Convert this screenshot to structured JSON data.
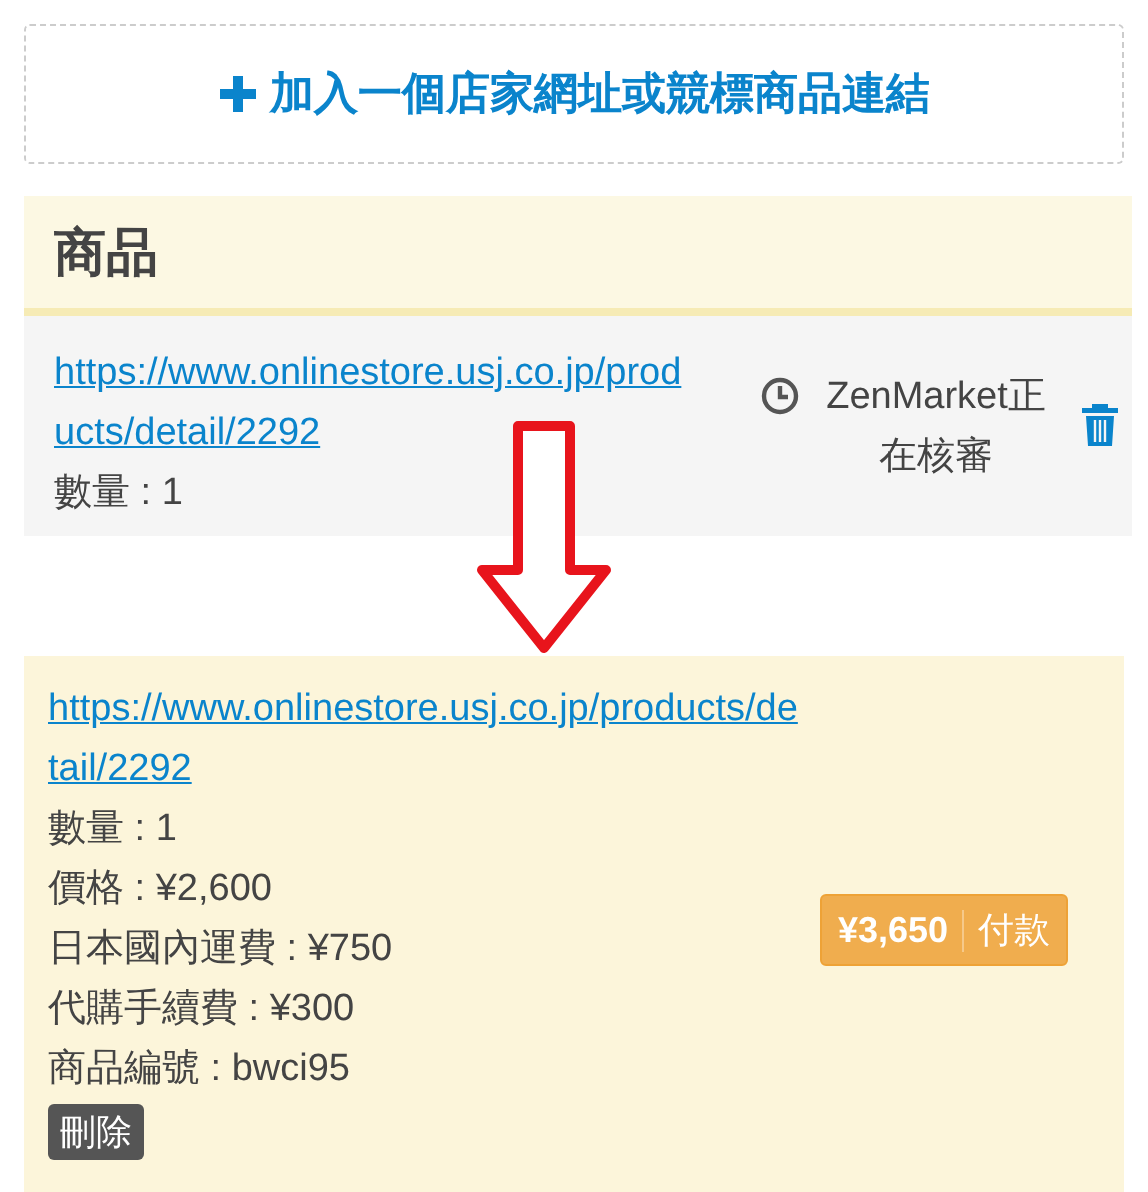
{
  "add_link": {
    "label": "加入一個店家網址或競標商品連結"
  },
  "products": {
    "title": "商品",
    "items": [
      {
        "url": "https://www.onlinestore.usj.co.jp/products/detail/2292",
        "quantity": "數量 : 1",
        "status": "ZenMarket正在核審"
      }
    ]
  },
  "order": {
    "url": "https://www.onlinestore.usj.co.jp/products/detail/2292",
    "lines": [
      "數量 : 1",
      "價格 : ¥2,600",
      "日本國內運費 : ¥750",
      "代購手續費 : ¥300",
      "商品編號 : bwci95"
    ],
    "total": "¥3,650",
    "pay": "付款",
    "delete": "刪除"
  }
}
